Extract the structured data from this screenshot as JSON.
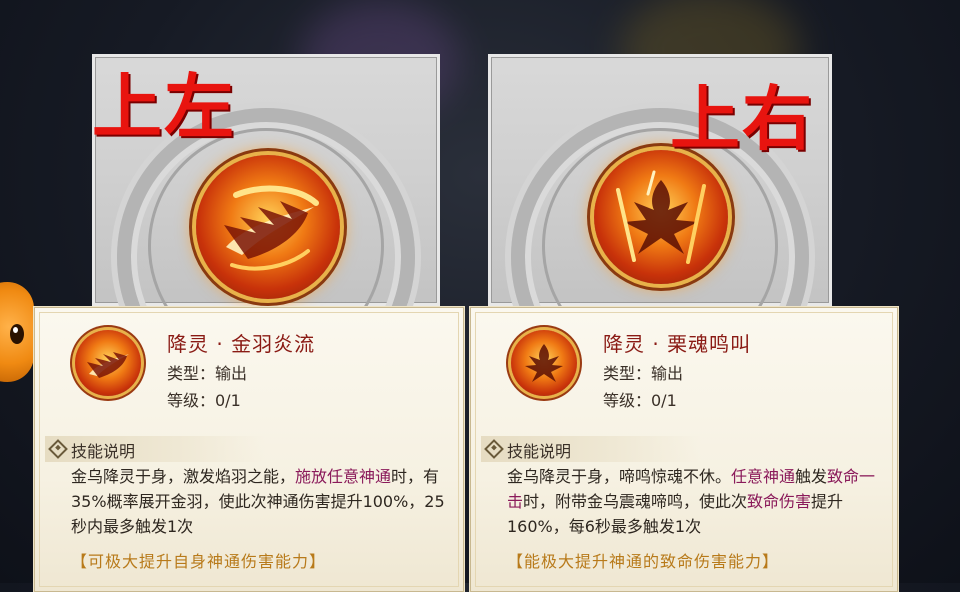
{
  "left": {
    "corner_label": "上左",
    "skill_name": "降灵 · 金羽炎流",
    "type_label": "类型：输出",
    "level_label": "等级：0/1",
    "section_title": "技能说明",
    "desc": [
      {
        "t": "金乌降灵于身，激发焰羽之能，",
        "hl": false
      },
      {
        "t": "施放任意神通",
        "hl": true
      },
      {
        "t": "时，有35%概率展开金羽，使此次神通伤害提升100%，25秒内最多触发1次",
        "hl": false
      }
    ],
    "note": "【可极大提升自身神通伤害能力】",
    "icon": "golden-feather-flame-icon"
  },
  "right": {
    "corner_label": "上右",
    "skill_name": "降灵 · 栗魂鸣叫",
    "type_label": "类型：输出",
    "level_label": "等级：0/1",
    "section_title": "技能说明",
    "desc": [
      {
        "t": "金乌降灵于身，啼鸣惊魂不休。",
        "hl": false
      },
      {
        "t": "任意神通",
        "hl": true
      },
      {
        "t": "触发",
        "hl": false
      },
      {
        "t": "致命一击",
        "hl": true
      },
      {
        "t": "时，附带金乌震魂啼鸣，使此次",
        "hl": false
      },
      {
        "t": "致命伤害",
        "hl": true
      },
      {
        "t": "提升160%，每6秒最多触发1次",
        "hl": false
      }
    ],
    "note": "【能极大提升神通的致命伤害能力】",
    "icon": "phoenix-cry-icon"
  },
  "colors": {
    "label_red": "#e8140f",
    "skill_name": "#8a1a14",
    "highlight": "#8a1a5a",
    "note": "#b87a1a"
  }
}
